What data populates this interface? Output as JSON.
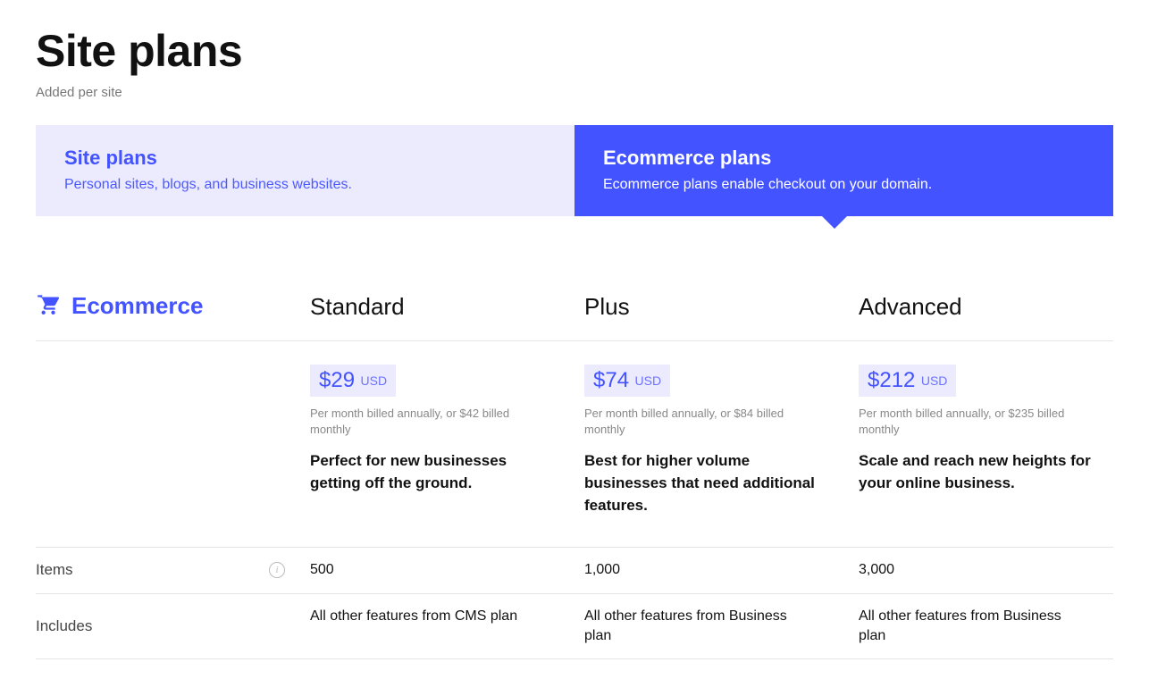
{
  "header": {
    "title": "Site plans",
    "subtitle": "Added per site"
  },
  "tabs": {
    "site": {
      "title": "Site plans",
      "desc": "Personal sites, blogs, and business websites."
    },
    "ecom": {
      "title": "Ecommerce plans",
      "desc": "Ecommerce plans enable checkout on your domain."
    }
  },
  "section_label": "Ecommerce",
  "plans": {
    "standard": {
      "name": "Standard",
      "price": "$29",
      "currency": "USD",
      "note": "Per month billed annually, or $42 billed monthly",
      "blurb": "Perfect for new businesses getting off the ground.",
      "items": "500",
      "includes": "All other features from CMS plan"
    },
    "plus": {
      "name": "Plus",
      "price": "$74",
      "currency": "USD",
      "note": "Per month billed annually, or $84 billed monthly",
      "blurb": "Best for higher volume businesses that need additional features.",
      "items": "1,000",
      "includes": "All other features from Business plan"
    },
    "advanced": {
      "name": "Advanced",
      "price": "$212",
      "currency": "USD",
      "note": "Per month billed annually, or $235 billed monthly",
      "blurb": "Scale and reach new heights for your online business.",
      "items": "3,000",
      "includes": "All other features from Business plan"
    }
  },
  "rows": {
    "items_label": "Items",
    "includes_label": "Includes"
  }
}
